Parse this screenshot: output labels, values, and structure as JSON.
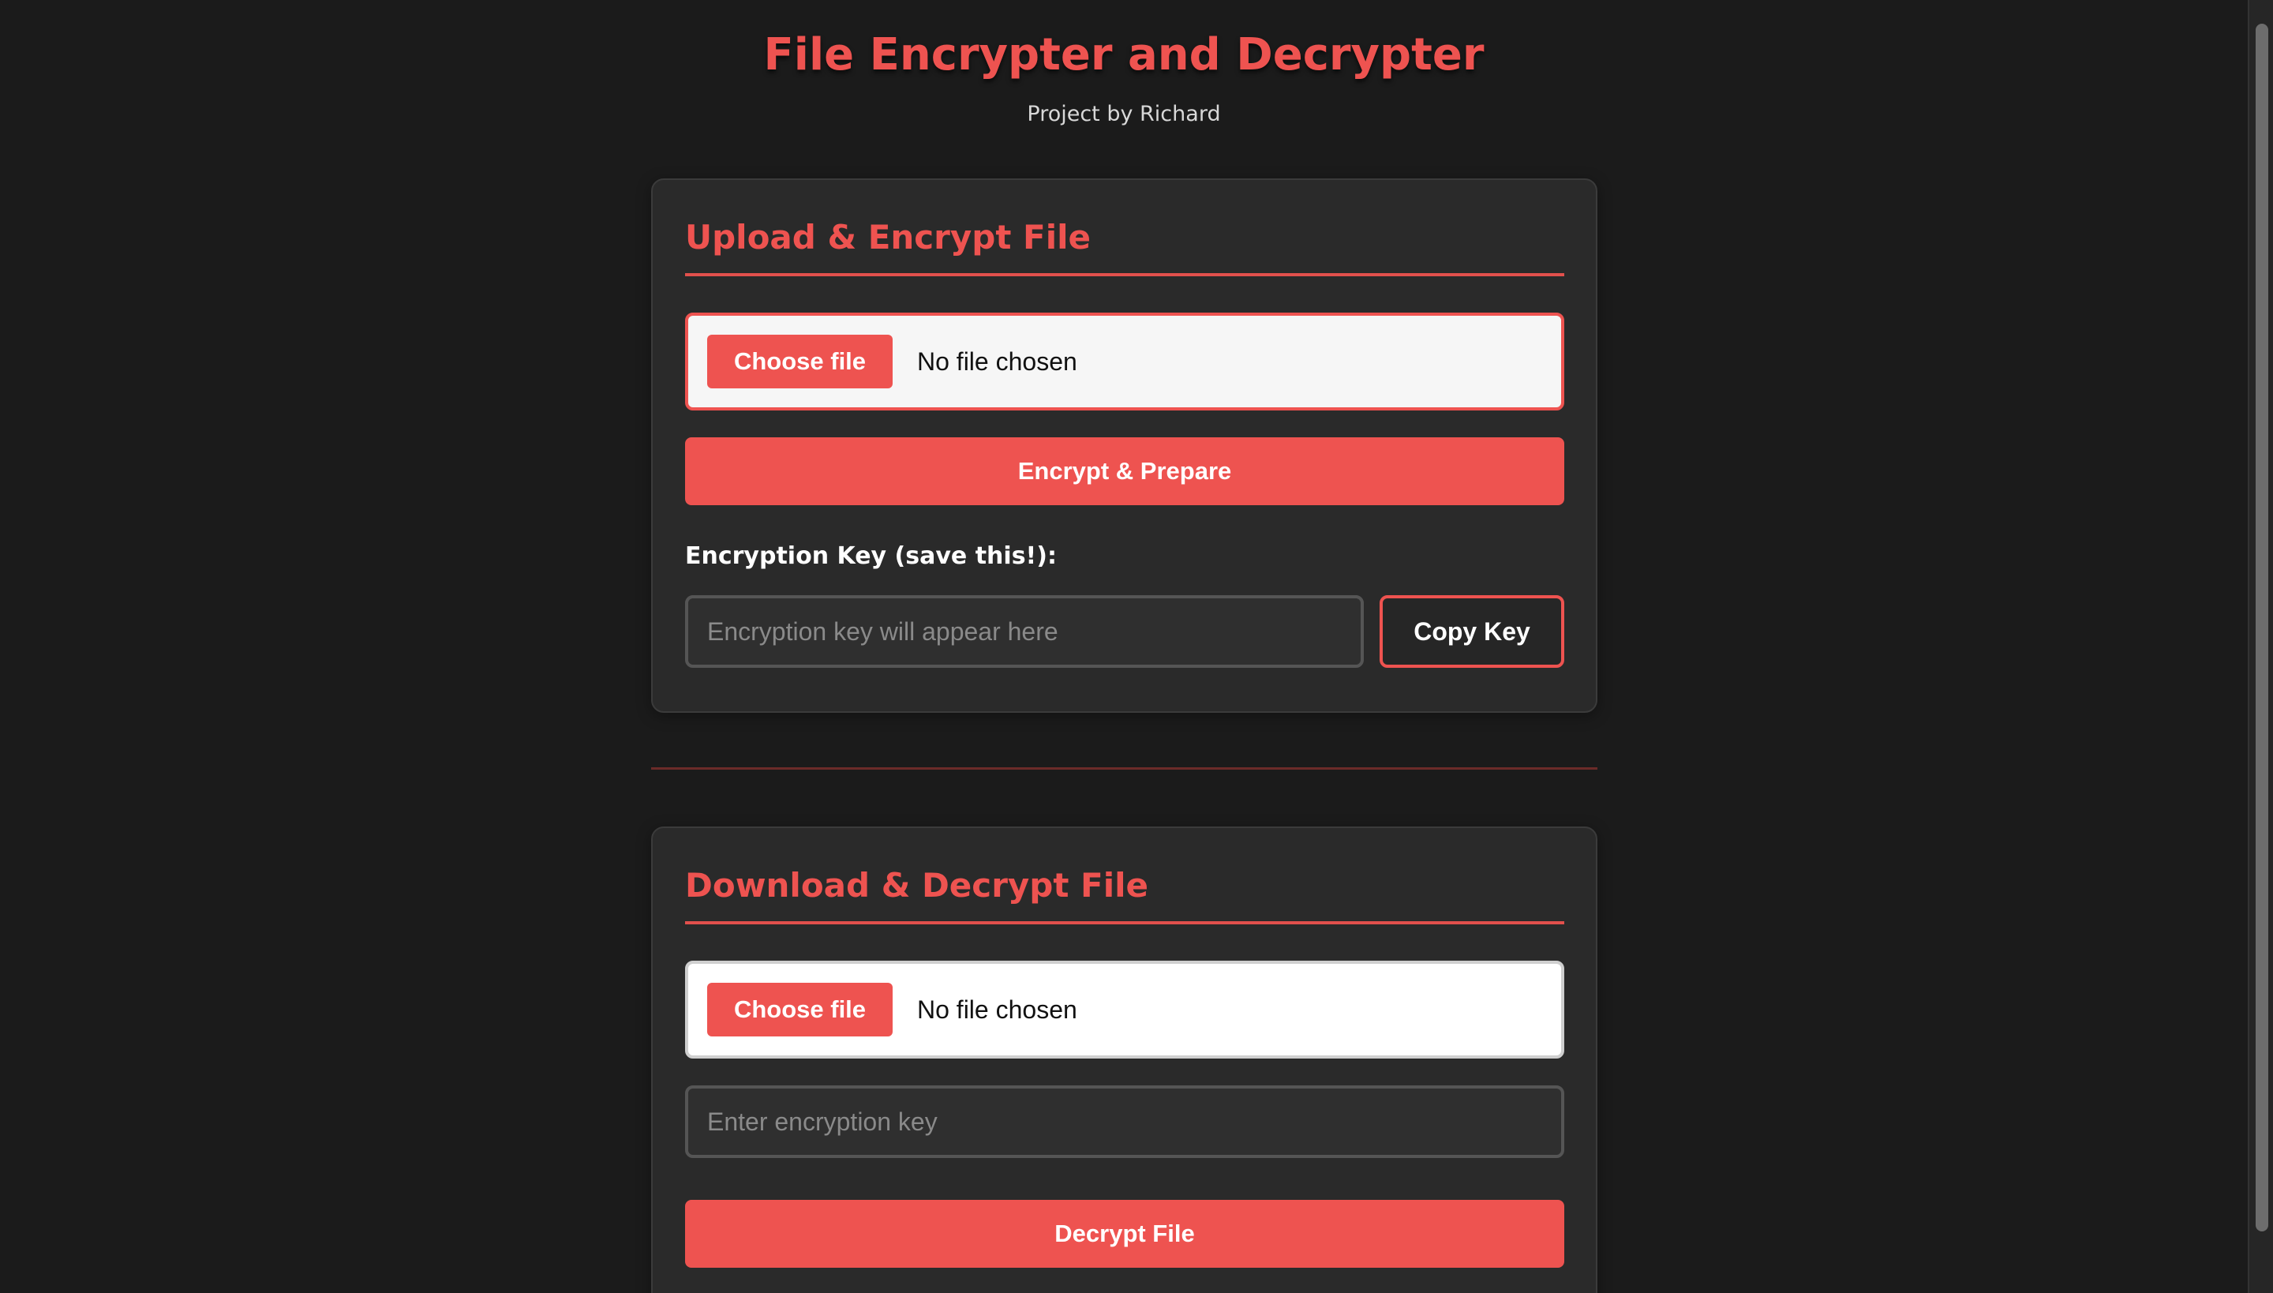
{
  "header": {
    "title": "File Encrypter and Decrypter",
    "subtitle": "Project by Richard"
  },
  "encrypt_section": {
    "heading": "Upload & Encrypt File",
    "file_input": {
      "button_label": "Choose file",
      "status": "No file chosen"
    },
    "submit_label": "Encrypt & Prepare",
    "key_label": "Encryption Key (save this!):",
    "key_placeholder": "Encryption key will appear here",
    "copy_label": "Copy Key"
  },
  "decrypt_section": {
    "heading": "Download & Decrypt File",
    "file_input": {
      "button_label": "Choose file",
      "status": "No file chosen"
    },
    "key_placeholder": "Enter encryption key",
    "submit_label": "Decrypt File"
  },
  "theme": {
    "accent": "#ee5350",
    "background": "#1b1b1b",
    "card": "#2a2a2a"
  }
}
